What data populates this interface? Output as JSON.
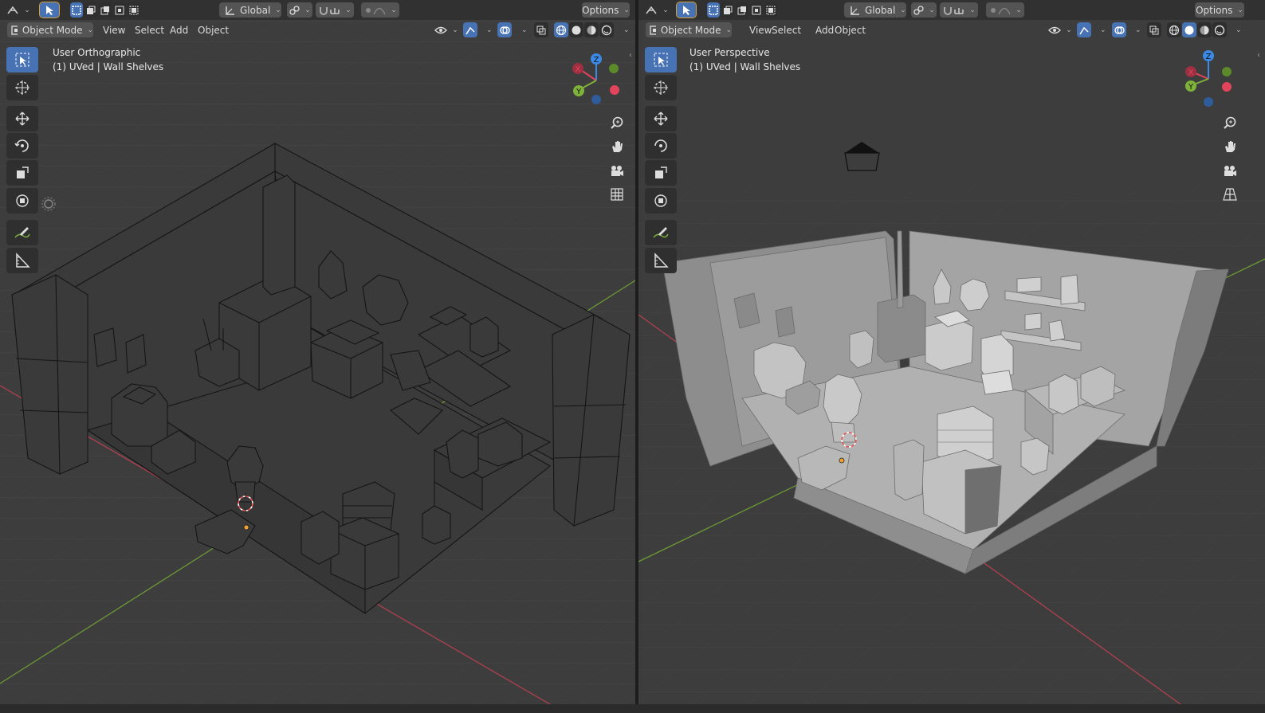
{
  "colors": {
    "viewport_bg": "#3d3d3d",
    "header_bg": "#303030",
    "active_blue": "#4772b3",
    "x_axis": "#e2445c",
    "y_axis": "#7fb23a",
    "z_axis": "#3b8ae6",
    "wire": "#111111",
    "solid_light": "#a9a9a9"
  },
  "left": {
    "header": {
      "orientation": "Global",
      "options": "Options",
      "mode": "Object Mode",
      "menu": {
        "view": "View",
        "select": "Select",
        "add": "Add",
        "object": "Object"
      }
    },
    "view_name": "User Orthographic",
    "object_info": "(1) UVed | Wall Shelves",
    "gizmo": {
      "x": "X",
      "y": "Y",
      "z": "Z"
    },
    "shading": "wireframe"
  },
  "right": {
    "header": {
      "orientation": "Global",
      "options": "Options",
      "mode": "Object Mode",
      "menu": {
        "view": "View",
        "select": "Select",
        "add": "Add",
        "object": "Object"
      }
    },
    "view_name": "User Perspective",
    "object_info": "(1) UVed | Wall Shelves",
    "gizmo": {
      "x": "X",
      "y": "Y",
      "z": "Z"
    },
    "shading": "solid"
  },
  "icons": {
    "tools": [
      "select-box-icon",
      "cursor-icon",
      "move-icon",
      "rotate-icon",
      "scale-icon",
      "transform-icon",
      "annotate-icon",
      "measure-icon"
    ],
    "nav": [
      "zoom-icon",
      "pan-hand-icon",
      "camera-icon",
      "grid-icon"
    ]
  }
}
